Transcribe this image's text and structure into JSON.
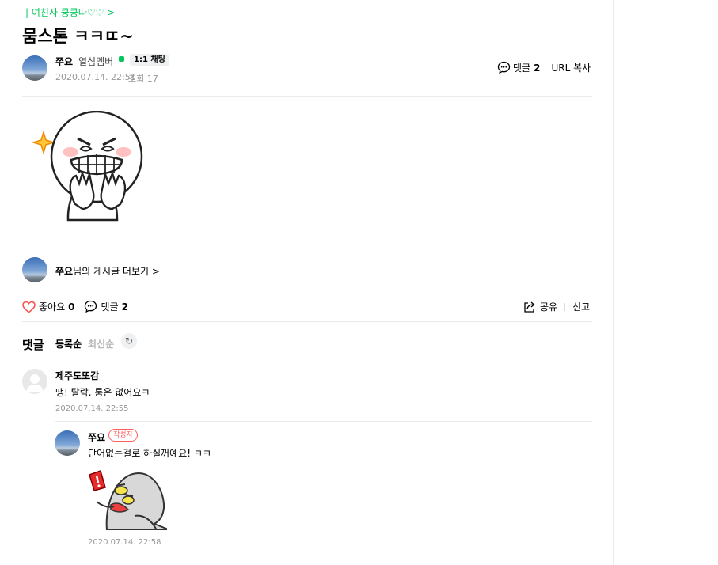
{
  "board": {
    "link_text": "| 여친사 쿵쿵따♡♡ >"
  },
  "post": {
    "title": "뭄스톤 ㅋㅋㄸ~",
    "author": "쭈요",
    "grade": "열심멤버",
    "chat_label": "1:1 채팅",
    "date": "2020.07.14. 22:51",
    "views": "조회 17",
    "comment_label": "댓글",
    "comment_count": "2",
    "url_copy": "URL 복사"
  },
  "more_posts": {
    "author": "쭈요",
    "suffix": "님의 게시글 더보기 >"
  },
  "reactions": {
    "like_label": "좋아요",
    "like_count": "0",
    "comment_label": "댓글",
    "comment_count": "2",
    "share_label": "공유",
    "report_label": "신고"
  },
  "comments_section": {
    "heading": "댓글",
    "sort_registered": "등록순",
    "sort_latest": "최신순"
  },
  "comments": [
    {
      "nickname": "제주도또감",
      "text": "땡! 탈락. 룸은 없어요ㅋ",
      "date": "2020.07.14. 22:55"
    },
    {
      "nickname": "쭈요",
      "badge": "작성자",
      "text": "단어없는걸로 하실꺼예요! ㅋㅋ",
      "date": "2020.07.14. 22:58"
    }
  ],
  "colors": {
    "accent": "#03c75a",
    "like_heart": "#ff4c4c",
    "writer_badge": "#ff5e5e"
  },
  "icons": {
    "like": "heart-outline-icon",
    "comment": "speech-bubble-icon",
    "share": "share-arrow-icon",
    "refresh": "refresh-icon"
  }
}
